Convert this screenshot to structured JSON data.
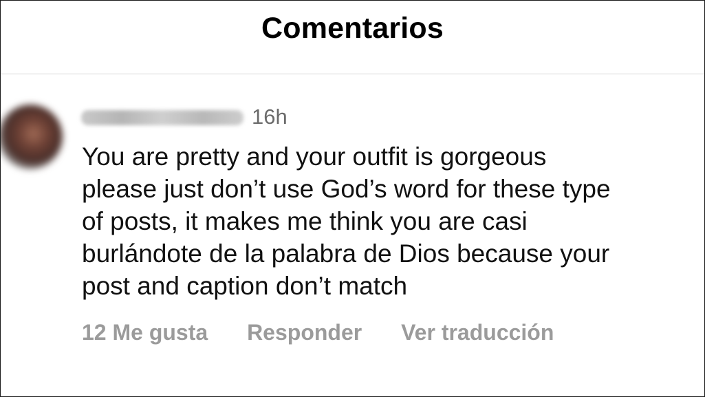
{
  "header": {
    "title": "Comentarios"
  },
  "comment": {
    "username": "eunicegarcia1",
    "timestamp": "16h",
    "text_lines": [
      "You are pretty and your outfit is gorgeous",
      "please just don’t use God’s word for these type",
      "of posts, it makes me think you are casi",
      "burlándote de la palabra de Dios because your",
      "post and caption don’t match"
    ],
    "actions": {
      "likes": "12 Me gusta",
      "reply": "Responder",
      "translate": "Ver traducción"
    }
  },
  "colors": {
    "title": "#000000",
    "text": "#111111",
    "timestamp": "#6b6b6b",
    "actions": "#9b9b9b",
    "divider": "#d6d6d6"
  }
}
